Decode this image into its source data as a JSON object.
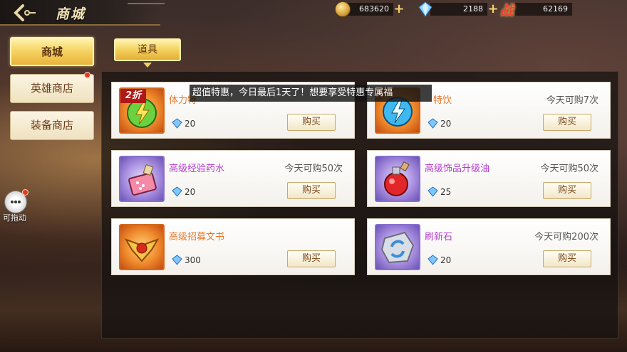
{
  "header": {
    "title": "商城"
  },
  "currency": {
    "gold": "683620",
    "diamond": "2188",
    "battle_label": "战",
    "battle_power": "62169"
  },
  "side_tabs": [
    {
      "label": "商城",
      "active": true,
      "notify": false
    },
    {
      "label": "英雄商店",
      "active": false,
      "notify": true
    },
    {
      "label": "装备商店",
      "active": false,
      "notify": false
    }
  ],
  "drag_label": "可拖动",
  "category_tab": "道具",
  "marquee": "超值特惠，今日最后1天了！想要享受特惠专属福",
  "buy_label": "购买",
  "items": [
    {
      "name": "体力特",
      "limit": "",
      "price": "20",
      "badge": "2折",
      "rarity": "orange",
      "icon": "lightning-green-icon"
    },
    {
      "name": "特饮",
      "limit": "今天可购7次",
      "price": "20",
      "badge": "",
      "rarity": "orange",
      "icon": "lightning-blue-icon"
    },
    {
      "name": "高级经验药水",
      "limit": "今天可购50次",
      "price": "20",
      "badge": "",
      "rarity": "purple",
      "icon": "exp-potion-icon"
    },
    {
      "name": "高级饰品升级油",
      "limit": "今天可购50次",
      "price": "25",
      "badge": "",
      "rarity": "purple",
      "icon": "red-potion-icon"
    },
    {
      "name": "高级招募文书",
      "limit": "",
      "price": "300",
      "badge": "",
      "rarity": "orange",
      "icon": "winged-emblem-icon"
    },
    {
      "name": "刷新石",
      "limit": "今天可购200次",
      "price": "20",
      "badge": "",
      "rarity": "purple",
      "icon": "refresh-stone-icon"
    }
  ]
}
